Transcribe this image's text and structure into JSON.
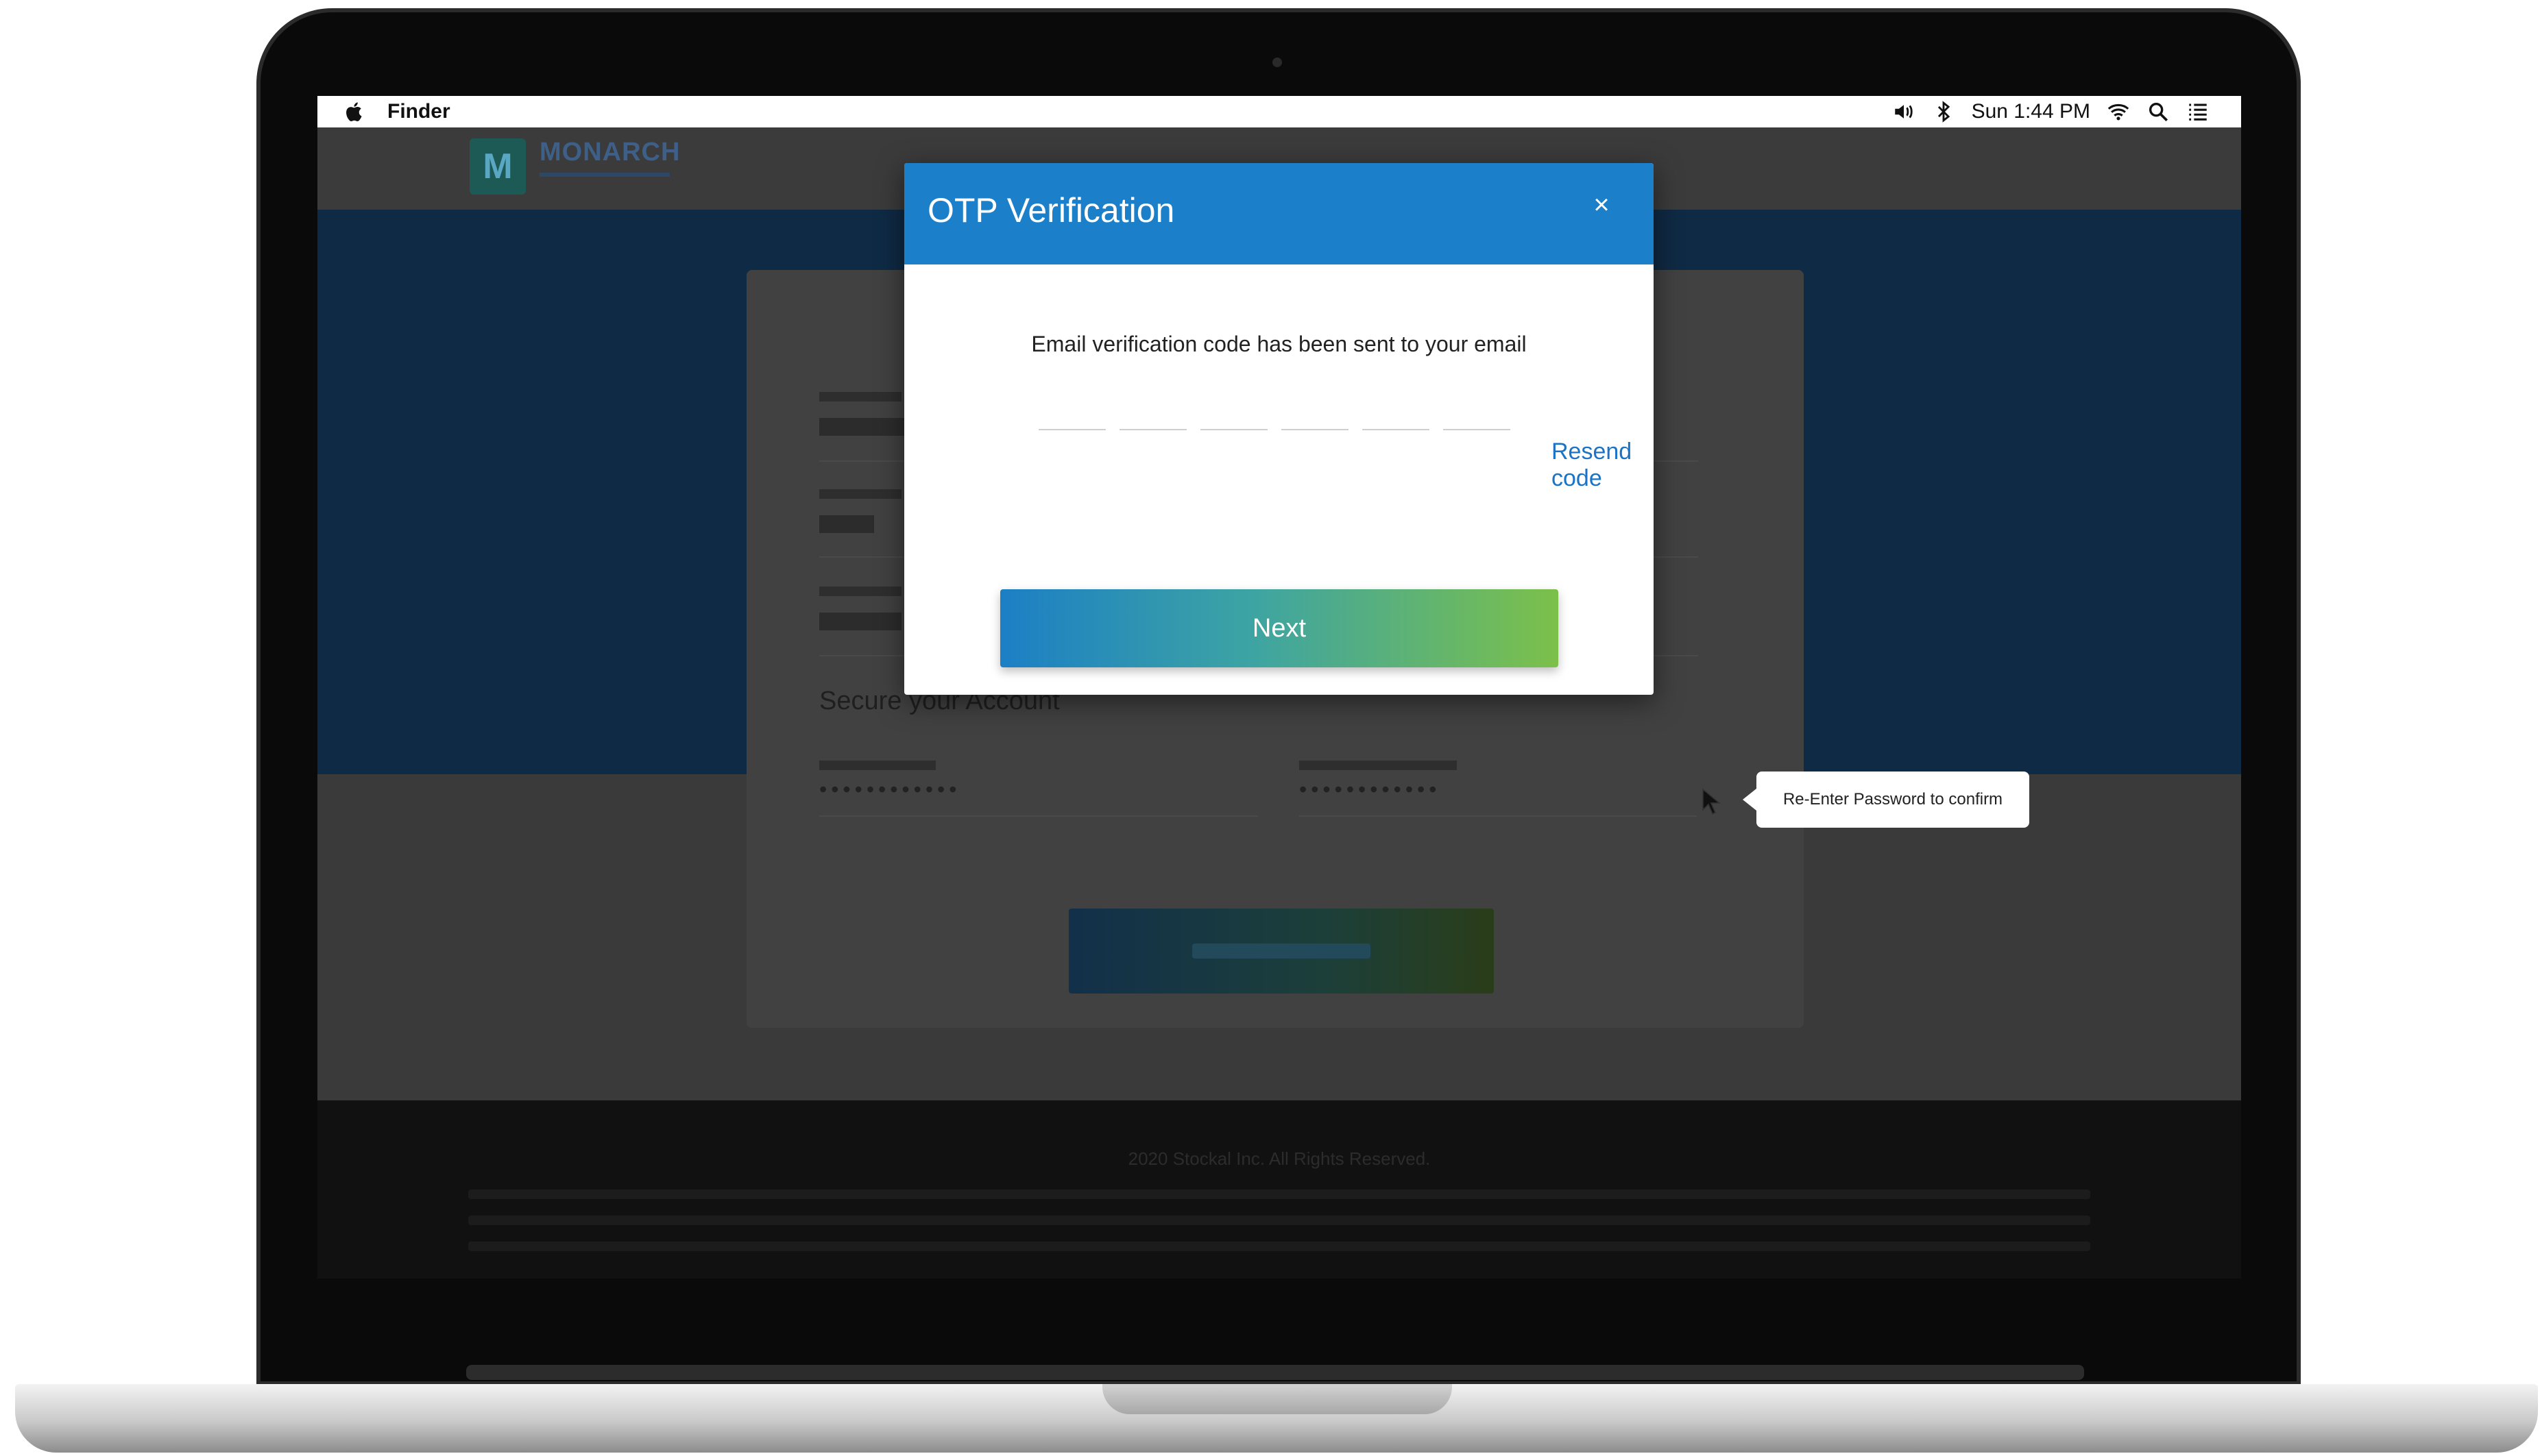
{
  "menubar": {
    "app_name": "Finder",
    "clock": "Sun 1:44 PM",
    "icons": [
      "apple-icon",
      "volume-icon",
      "bluetooth-icon",
      "wifi-icon",
      "search-icon",
      "list-icon"
    ]
  },
  "app": {
    "logo_letter": "M",
    "logo_text": "MONARCH"
  },
  "form": {
    "secure_title": "Secure your Account",
    "password_mask": "••••••••••••",
    "confirm_mask": "••••••••••••",
    "tooltip": "Re-Enter Password to confirm"
  },
  "footer": {
    "copyright": "2020 Stockal Inc. All Rights Reserved."
  },
  "modal": {
    "title": "OTP Verification",
    "close_icon": "close-icon",
    "message": "Email verification code has been sent to your email",
    "otp_digits": [
      "",
      "",
      "",
      "",
      "",
      ""
    ],
    "resend_label": "Resend code",
    "next_label": "Next"
  },
  "colors": {
    "modal_header": "#1b7fc9",
    "link": "#1a73c4",
    "next_gradient_start": "#1c7fc5",
    "next_gradient_end": "#7cc04a"
  }
}
